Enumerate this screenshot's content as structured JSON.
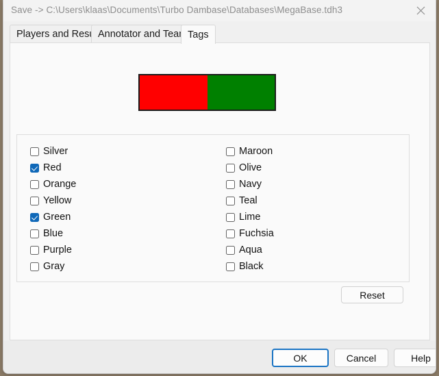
{
  "window": {
    "title": "Save -> C:\\Users\\klaas\\Documents\\Turbo Dambase\\Databases\\MegaBase.tdh3",
    "close_label": "✕"
  },
  "tabs": [
    {
      "label": "Players and Result",
      "active": false
    },
    {
      "label": "Annotator and Teams",
      "active": false
    },
    {
      "label": "Tags",
      "active": true
    }
  ],
  "preview": {
    "colors": [
      "#ff0000",
      "#008000"
    ],
    "border_color": "#1b1b1b"
  },
  "tags": {
    "accent_checked_color": "#0f68b8",
    "left_column": [
      {
        "label": "Silver",
        "checked": false
      },
      {
        "label": "Red",
        "checked": true
      },
      {
        "label": "Orange",
        "checked": false
      },
      {
        "label": "Yellow",
        "checked": false
      },
      {
        "label": "Green",
        "checked": true
      },
      {
        "label": "Blue",
        "checked": false
      },
      {
        "label": "Purple",
        "checked": false
      },
      {
        "label": "Gray",
        "checked": false
      }
    ],
    "right_column": [
      {
        "label": "Maroon",
        "checked": false
      },
      {
        "label": "Olive",
        "checked": false
      },
      {
        "label": "Navy",
        "checked": false
      },
      {
        "label": "Teal",
        "checked": false
      },
      {
        "label": "Lime",
        "checked": false
      },
      {
        "label": "Fuchsia",
        "checked": false
      },
      {
        "label": "Aqua",
        "checked": false
      },
      {
        "label": "Black",
        "checked": false
      }
    ],
    "reset_label": "Reset"
  },
  "buttons": {
    "ok": "OK",
    "cancel": "Cancel",
    "help": "Help"
  }
}
